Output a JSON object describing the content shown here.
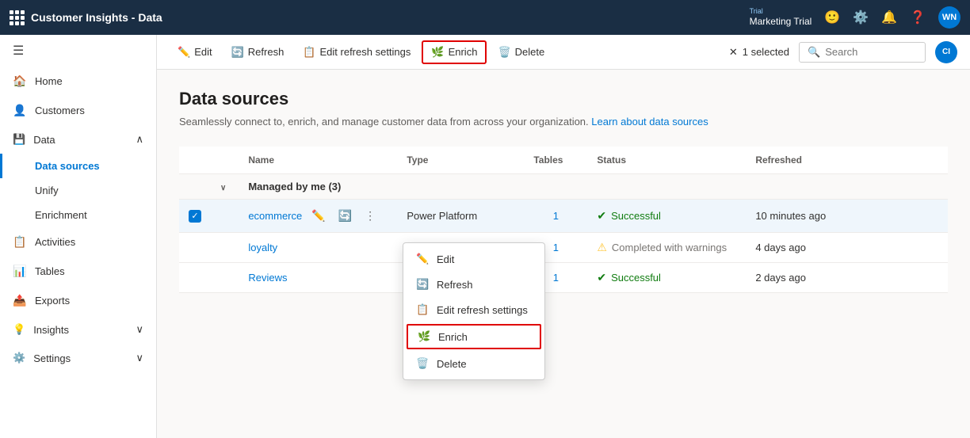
{
  "app": {
    "title": "Customer Insights - Data",
    "trial_label": "Trial",
    "trial_name": "Marketing Trial",
    "avatar_initials": "WN"
  },
  "toolbar": {
    "edit_label": "Edit",
    "refresh_label": "Refresh",
    "edit_refresh_label": "Edit refresh settings",
    "enrich_label": "Enrich",
    "delete_label": "Delete",
    "selected_text": "1 selected",
    "search_placeholder": "Search"
  },
  "sidebar": {
    "toggle_icon": "☰",
    "home_label": "Home",
    "customers_label": "Customers",
    "data_label": "Data",
    "data_sources_label": "Data sources",
    "unify_label": "Unify",
    "enrichment_label": "Enrichment",
    "activities_label": "Activities",
    "tables_label": "Tables",
    "exports_label": "Exports",
    "insights_label": "Insights",
    "settings_label": "Settings"
  },
  "page": {
    "title": "Data sources",
    "subtitle": "Seamlessly connect to, enrich, and manage customer data from across your organization.",
    "learn_link": "Learn about data sources"
  },
  "table": {
    "columns": [
      "Name",
      "Type",
      "Tables",
      "Status",
      "Refreshed"
    ],
    "group_label": "Managed by me (3)",
    "rows": [
      {
        "name": "ecommerce",
        "type": "Power Platform",
        "tables": "1",
        "status": "Successful",
        "status_type": "success",
        "refreshed": "10 minutes ago",
        "selected": true
      },
      {
        "name": "loyalty",
        "type": "",
        "tables": "1",
        "status": "Completed with warnings",
        "status_type": "warning",
        "refreshed": "4 days ago",
        "selected": false
      },
      {
        "name": "Reviews",
        "type": "",
        "tables": "1",
        "status": "Successful",
        "status_type": "success",
        "refreshed": "2 days ago",
        "selected": false
      }
    ]
  },
  "context_menu": {
    "items": [
      {
        "icon": "✏️",
        "label": "Edit"
      },
      {
        "icon": "🔄",
        "label": "Refresh"
      },
      {
        "icon": "📋",
        "label": "Edit refresh settings"
      },
      {
        "icon": "🌿",
        "label": "Enrich",
        "highlighted": true
      },
      {
        "icon": "🗑️",
        "label": "Delete"
      }
    ]
  }
}
